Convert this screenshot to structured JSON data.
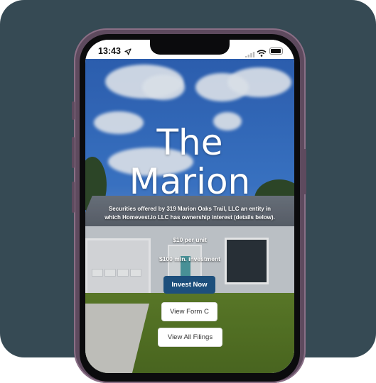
{
  "status_bar": {
    "time": "13:43",
    "location_icon": "location-arrow-icon",
    "signal_icon": "cellular-signal-icon",
    "wifi_icon": "wifi-icon",
    "battery_icon": "battery-icon"
  },
  "hero": {
    "title_line1": "The",
    "title_line2": "Marion",
    "description": "Securities offered by 319 Marion Oaks Trail, LLC an entity in which Homevest.io LLC has ownership interest (details below).",
    "price_per_unit": "$10 per unit",
    "min_investment": "$100 min. investment"
  },
  "actions": {
    "invest_label": "Invest Now",
    "form_c_label": "View Form C",
    "filings_label": "View All Filings"
  },
  "colors": {
    "background": "#364a54",
    "phone_frame": "#5e4a5e",
    "invest_button": "#1d4f7c"
  }
}
